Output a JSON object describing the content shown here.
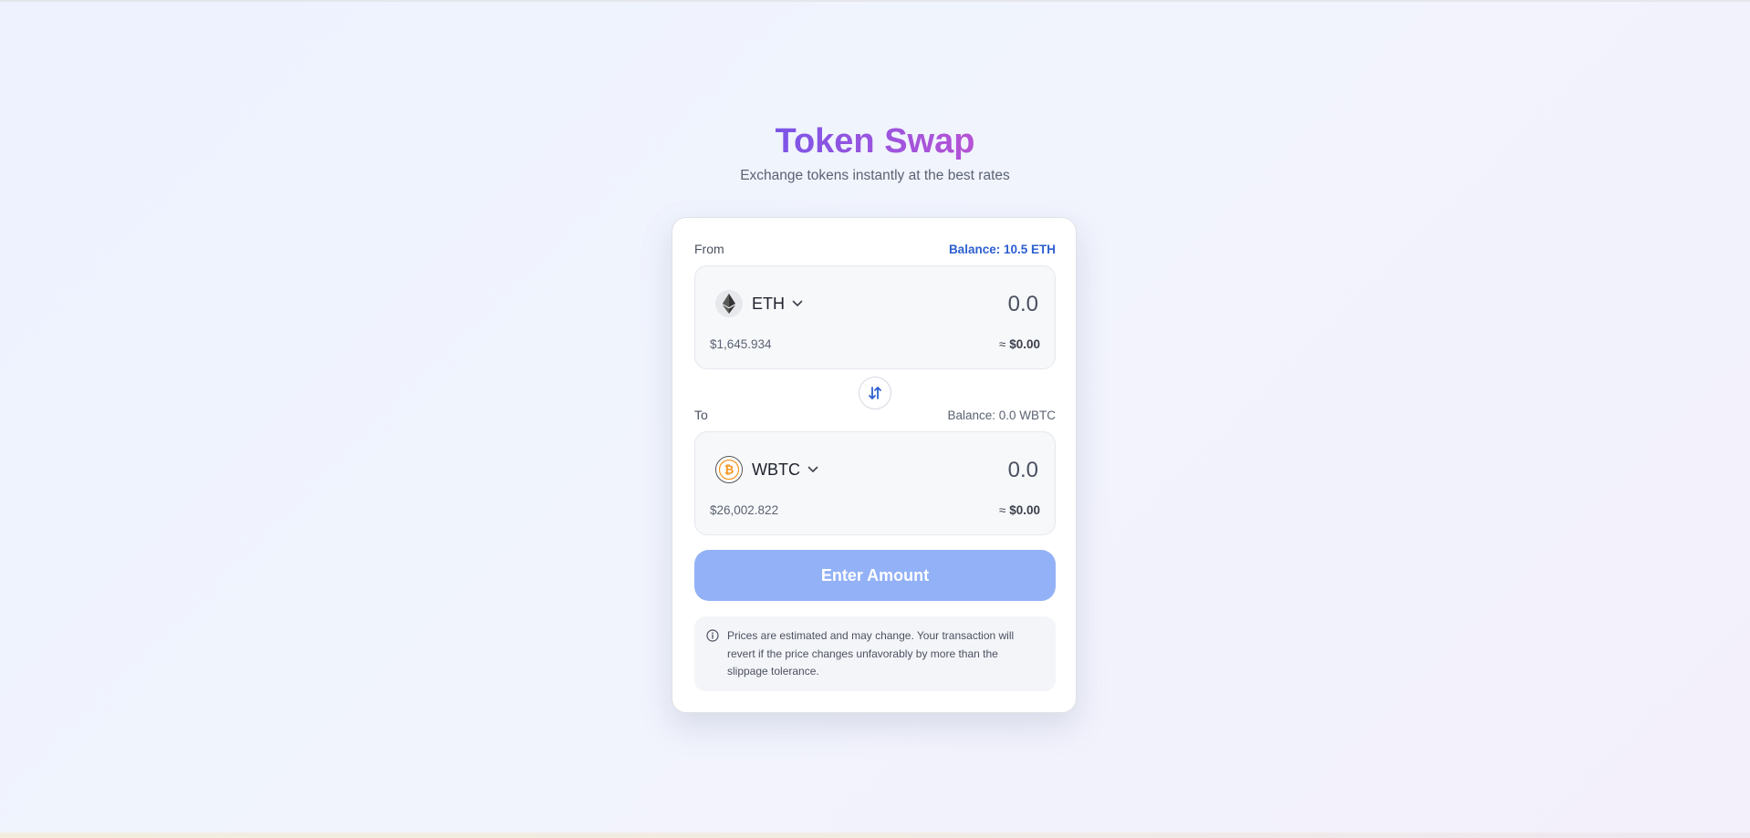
{
  "header": {
    "title": "Token Swap",
    "subtitle": "Exchange tokens instantly at the best rates"
  },
  "from": {
    "label": "From",
    "balance": "Balance: 10.5 ETH",
    "token": "ETH",
    "token_icon": "ethereum-icon",
    "amount_placeholder": "0.0",
    "price": "$1,645.934",
    "usd_prefix": "≈",
    "usd_value": "$0.00"
  },
  "to": {
    "label": "To",
    "balance": "Balance: 0.0 WBTC",
    "token": "WBTC",
    "token_icon": "bitcoin-icon",
    "amount_placeholder": "0.0",
    "price": "$26,002.822",
    "usd_prefix": "≈",
    "usd_value": "$0.00"
  },
  "swap_icon": "swap-arrows-icon",
  "action": {
    "label": "Enter Amount"
  },
  "notice": {
    "icon": "info-icon",
    "text": "Prices are estimated and may change. Your transaction will revert if the price changes unfavorably by more than the slippage tolerance."
  },
  "colors": {
    "accent": "#2d5fd0",
    "button_disabled": "#93b1f7",
    "title_gradient_start": "#7c55e6",
    "title_gradient_end": "#b653d6",
    "btc_orange": "#f7931a"
  }
}
